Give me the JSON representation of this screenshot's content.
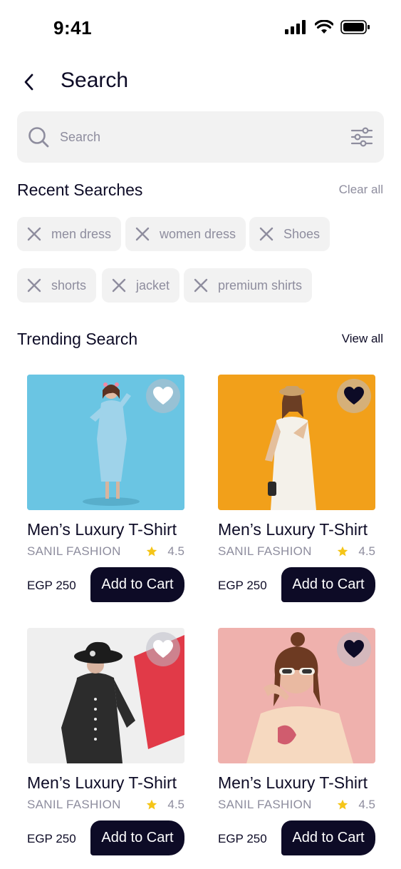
{
  "status_bar": {
    "time": "9:41"
  },
  "header": {
    "title": "Search"
  },
  "search": {
    "placeholder": "Search"
  },
  "recent": {
    "title": "Recent Searches",
    "clear_label": "Clear all",
    "chips": [
      "men dress",
      "women dress",
      "Shoes",
      "shorts",
      "jacket",
      "premium shirts"
    ]
  },
  "trending": {
    "title": "Trending Search",
    "view_all_label": "View all",
    "products": [
      {
        "name": "Men’s Luxury T-Shirt",
        "brand": "SANIL FASHION",
        "rating": "4.5",
        "price": "EGP 250",
        "cta": "Add to Cart",
        "favorite": false,
        "image": "woman-blue-dress-photo"
      },
      {
        "name": "Men’s Luxury T-Shirt",
        "brand": "SANIL FASHION",
        "rating": "4.5",
        "price": "EGP 250",
        "cta": "Add to Cart",
        "favorite": true,
        "image": "woman-white-dress-photo"
      },
      {
        "name": "Men’s Luxury T-Shirt",
        "brand": "SANIL FASHION",
        "rating": "4.5",
        "price": "EGP 250",
        "cta": "Add to Cart",
        "favorite": false,
        "image": "woman-black-hat-photo"
      },
      {
        "name": "Men’s Luxury T-Shirt",
        "brand": "SANIL FASHION",
        "rating": "4.5",
        "price": "EGP 250",
        "cta": "Add to Cart",
        "favorite": true,
        "image": "woman-sunglasses-photo"
      }
    ]
  },
  "colors": {
    "primary": "#0d0b26",
    "muted": "#8e8d9e",
    "surface": "#f2f2f2",
    "star": "#f5c518"
  }
}
